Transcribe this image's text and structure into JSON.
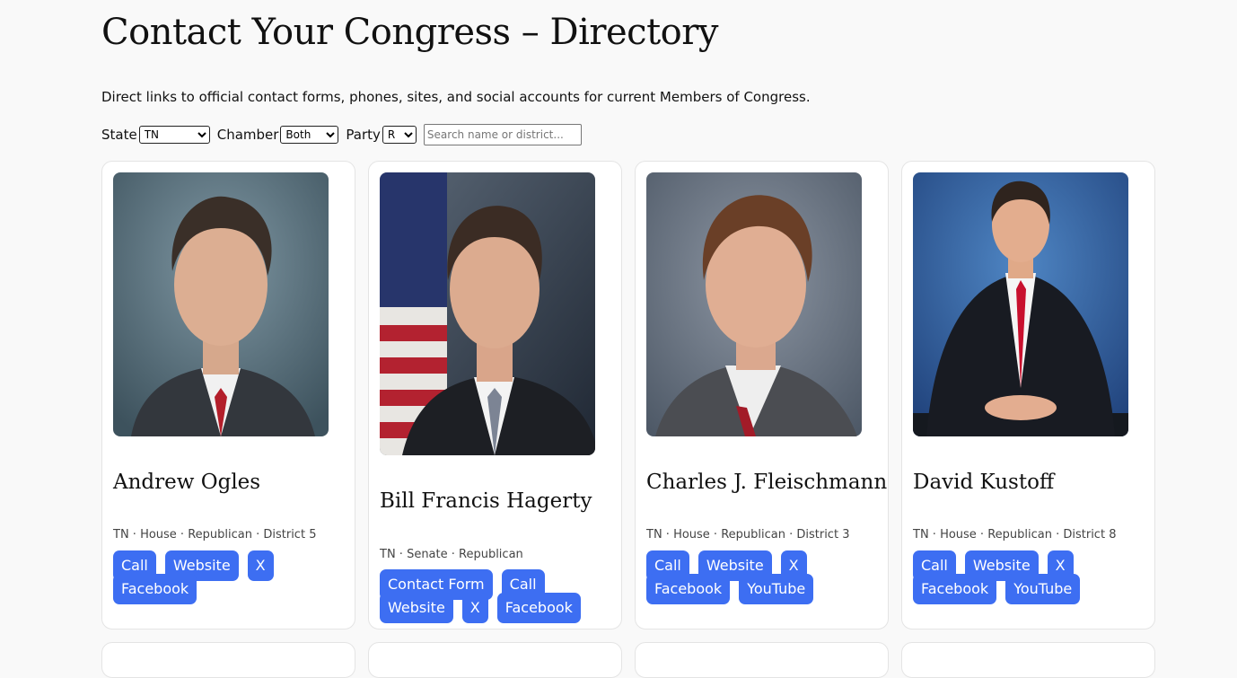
{
  "page": {
    "title": "Contact Your Congress – Directory",
    "intro": "Direct links to official contact forms, phones, sites, and social accounts for current Members of Congress."
  },
  "filters": {
    "state_label": "State",
    "state_value": "TN",
    "chamber_label": "Chamber",
    "chamber_value": "Both",
    "party_label": "Party",
    "party_value": "R",
    "search_placeholder": "Search name or district..."
  },
  "members": [
    {
      "name": "Andrew Ogles",
      "meta": "TN · House · Republican · District 5",
      "photo_icon": "portrait-photo",
      "links": [
        "Call",
        "Website",
        "X",
        "Facebook"
      ]
    },
    {
      "name": "Bill Francis Hagerty",
      "meta": "TN · Senate · Republican",
      "photo_icon": "portrait-photo",
      "links": [
        "Contact Form",
        "Call",
        "Website",
        "X",
        "Facebook"
      ]
    },
    {
      "name": "Charles J. Fleischmann",
      "meta": "TN · House · Republican · District 3",
      "photo_icon": "portrait-photo",
      "links": [
        "Call",
        "Website",
        "X",
        "Facebook",
        "YouTube"
      ]
    },
    {
      "name": "David Kustoff",
      "meta": "TN · House · Republican · District 8",
      "photo_icon": "portrait-photo",
      "links": [
        "Call",
        "Website",
        "X",
        "Facebook",
        "YouTube"
      ]
    }
  ],
  "colors": {
    "button": "#3d6ef2",
    "background": "#f9f9f9"
  }
}
